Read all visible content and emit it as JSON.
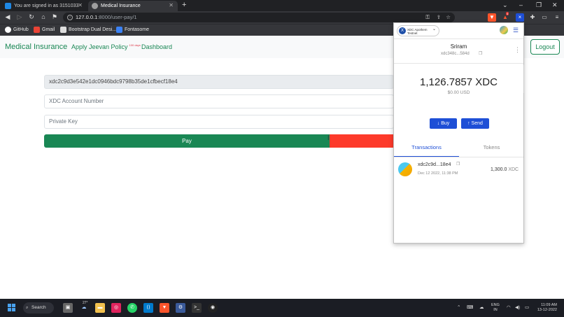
{
  "browser": {
    "tabs": [
      {
        "label": "You are signed in as 3151033",
        "favicon_color": "#1e88e5"
      },
      {
        "label": "Medical Insurance",
        "favicon_color": "#9e9e9e"
      }
    ],
    "url_host": "127.0.0.1",
    "url_path": ":8000/user-pay/1",
    "bookmarks": [
      "GitHub",
      "Gmail",
      "Bootstrap Dual Desi...",
      "Fontasome"
    ],
    "new_tab_icon": "+",
    "window_controls": [
      "⌄",
      "–",
      "❐",
      "✕"
    ],
    "extension_badge": "4"
  },
  "navbar": {
    "brand": "Medical Insurance",
    "apply_label": "Apply Jeevan Policy",
    "apply_badge": "100 days",
    "dashboard_label": "Dashboard",
    "logout_label": "Logout"
  },
  "form": {
    "address_value": "xdc2c9d3e542e1dc0946bdc9798b35de1cfbecf18e4",
    "account_placeholder": "XDC Account Number",
    "key_placeholder": "Private Key",
    "pay_label": "Pay"
  },
  "wallet": {
    "network_line1": "XDC Apothem",
    "network_line2": "Testnet",
    "network_logo": "X",
    "account_name": "Sriram",
    "account_address": "xdc348c...584d",
    "balance": "1,126.7857 XDC",
    "balance_usd": "$0.00 USD",
    "buy_label": "Buy",
    "send_label": "Send",
    "tab_transactions": "Transactions",
    "tab_tokens": "Tokens",
    "transaction": {
      "address": "xdc2c9d...18e4",
      "date": "Dec 12 2022, 11:38 PM",
      "amount": "1,300.0",
      "unit": "XDC"
    }
  },
  "taskbar": {
    "search_label": "Search",
    "weather_temp": "27°",
    "lang_line1": "ENG",
    "lang_line2": "IN",
    "time": "11:09 AM",
    "date": "13-12-2022"
  },
  "colors": {
    "accent_green": "#198754",
    "wallet_blue": "#1e4fd6",
    "danger_red": "#fd3a2a"
  }
}
